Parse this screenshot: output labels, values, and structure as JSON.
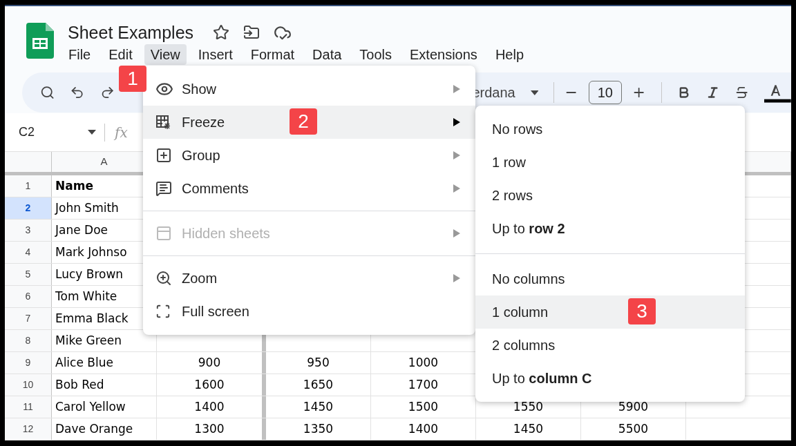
{
  "document": {
    "title": "Sheet Examples"
  },
  "menu_bar": [
    {
      "label": "File",
      "selected": false
    },
    {
      "label": "Edit",
      "selected": false
    },
    {
      "label": "View",
      "selected": true
    },
    {
      "label": "Insert",
      "selected": false
    },
    {
      "label": "Format",
      "selected": false
    },
    {
      "label": "Data",
      "selected": false
    },
    {
      "label": "Tools",
      "selected": false
    },
    {
      "label": "Extensions",
      "selected": false
    },
    {
      "label": "Help",
      "selected": false
    }
  ],
  "toolbar": {
    "font": "erdana",
    "font_size": "10"
  },
  "name_box": "C2",
  "function_label": "fx",
  "column_headers": [
    "A"
  ],
  "rows": [
    {
      "number": "1",
      "selected": false,
      "cells": [
        "Name"
      ]
    },
    {
      "number": "2",
      "selected": true,
      "cells": [
        "John Smith"
      ]
    },
    {
      "number": "3",
      "selected": false,
      "cells": [
        "Jane Doe"
      ]
    },
    {
      "number": "4",
      "selected": false,
      "cells": [
        "Mark Johnso"
      ]
    },
    {
      "number": "5",
      "selected": false,
      "cells": [
        "Lucy Brown"
      ]
    },
    {
      "number": "6",
      "selected": false,
      "cells": [
        "Tom White"
      ]
    },
    {
      "number": "7",
      "selected": false,
      "cells": [
        "Emma Black"
      ]
    },
    {
      "number": "8",
      "selected": false,
      "cells": [
        "Mike Green"
      ]
    },
    {
      "number": "9",
      "selected": false,
      "cells": [
        "Alice Blue",
        "900",
        "950",
        "1000"
      ]
    },
    {
      "number": "10",
      "selected": false,
      "cells": [
        "Bob Red",
        "1600",
        "1650",
        "1700"
      ]
    },
    {
      "number": "11",
      "selected": false,
      "cells": [
        "Carol Yellow",
        "1400",
        "1450",
        "1500",
        "1550",
        "5900"
      ]
    },
    {
      "number": "12",
      "selected": false,
      "cells": [
        "Dave Orange",
        "1300",
        "1350",
        "1400",
        "1450",
        "5500"
      ]
    }
  ],
  "view_menu": {
    "groups": [
      [
        {
          "label": "Show",
          "selected": false,
          "disabled": false,
          "submenu": true
        },
        {
          "label": "Freeze",
          "selected": true,
          "disabled": false,
          "submenu": true
        },
        {
          "label": "Group",
          "selected": false,
          "disabled": false,
          "submenu": true
        },
        {
          "label": "Comments",
          "selected": false,
          "disabled": false,
          "submenu": true
        }
      ],
      [
        {
          "label": "Hidden sheets",
          "selected": false,
          "disabled": true,
          "submenu": true
        }
      ],
      [
        {
          "label": "Zoom",
          "selected": false,
          "disabled": false,
          "submenu": true
        },
        {
          "label": "Full screen",
          "selected": false,
          "disabled": false,
          "submenu": false
        }
      ]
    ]
  },
  "freeze_submenu": {
    "groups": [
      [
        {
          "label": "No rows",
          "selected": false
        },
        {
          "label": "1 row",
          "selected": false
        },
        {
          "label": "2 rows",
          "selected": false
        },
        {
          "label": "Up to **row 2**",
          "selected": false
        }
      ],
      [
        {
          "label": "No columns",
          "selected": false
        },
        {
          "label": "1 column",
          "selected": true
        },
        {
          "label": "2 columns",
          "selected": false
        },
        {
          "label": "Up to **column C**",
          "selected": false
        }
      ]
    ]
  },
  "annotations": [
    "1",
    "2",
    "3"
  ]
}
